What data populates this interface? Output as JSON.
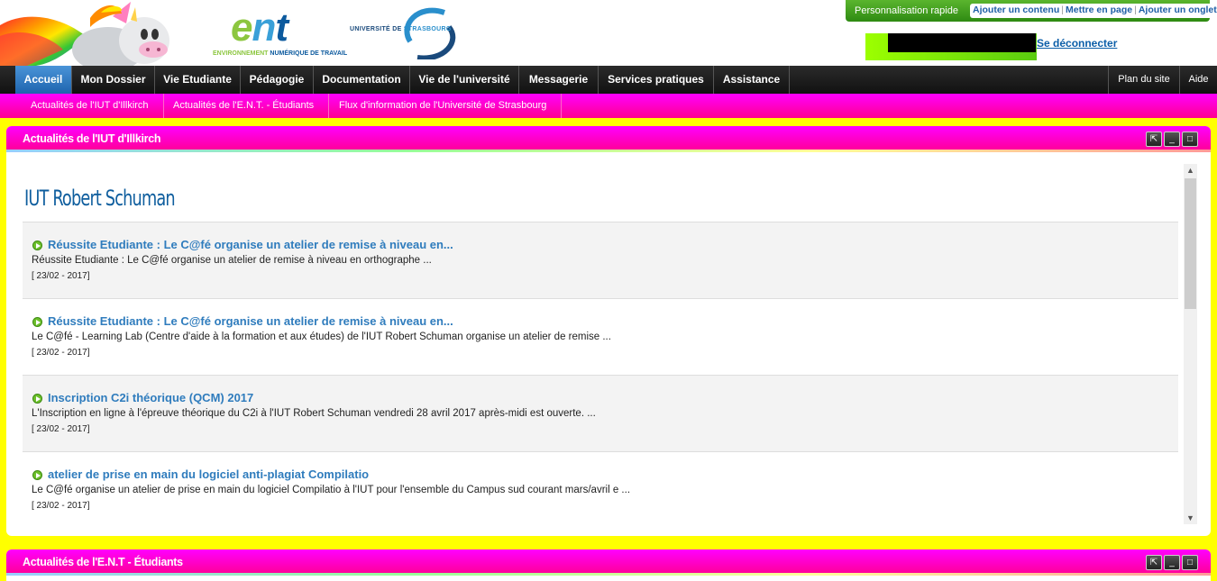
{
  "header": {
    "ent_letters": [
      "e",
      "n",
      "t"
    ],
    "ent_subtitle_a": "ENVIRONNEMENT",
    "ent_subtitle_b": "NUMÉRIQUE DE TRAVAIL",
    "unistra_a": "UNIVERSITÉ DE",
    "unistra_b": "STRASBOURG",
    "quick_label": "Personnalisation rapide",
    "quick_links": [
      "Ajouter un contenu",
      "Mettre en page",
      "Ajouter un onglet"
    ],
    "logout": "Se déconnecter"
  },
  "nav": {
    "items": [
      "Accueil",
      "Mon Dossier",
      "Vie Etudiante",
      "Pédagogie",
      "Documentation",
      "Vie de l'université",
      "Messagerie",
      "Services pratiques",
      "Assistance"
    ],
    "active_index": 0,
    "right": [
      "Plan du site",
      "Aide"
    ]
  },
  "subnav": [
    "Actualités de l'IUT d'Illkirch",
    "Actualités de l'E.N.T. - Étudiants",
    "Flux d'information de l'Université de Strasbourg"
  ],
  "portlet1": {
    "title": "Actualités de l'IUT d'Illkirch",
    "heading": "IUT Robert Schuman",
    "news": [
      {
        "title": "Réussite Etudiante : Le C@fé organise un atelier de remise à niveau en...",
        "desc": "Réussite Etudiante : Le C@fé organise un atelier de remise à niveau en orthographe ...",
        "date": "[ 23/02 - 2017]"
      },
      {
        "title": "Réussite Etudiante : Le C@fé organise un atelier de remise à niveau en...",
        "desc": "Le C@fé - Learning Lab (Centre d'aide à la formation et aux études) de l'IUT Robert Schuman organise un atelier de remise ...",
        "date": "[ 23/02 - 2017]"
      },
      {
        "title": "Inscription C2i théorique (QCM) 2017",
        "desc": "L'Inscription en ligne à l'épreuve théorique du C2i à l'IUT Robert Schuman vendredi 28 avril 2017 après-midi est ouverte. ...",
        "date": "[ 23/02 - 2017]"
      },
      {
        "title": "atelier de prise en main du logiciel anti-plagiat Compilatio",
        "desc": "Le C@fé organise un atelier de prise en main du logiciel Compilatio à l'IUT pour l'ensemble du Campus sud courant mars/avril e ...",
        "date": "[ 23/02 - 2017]"
      }
    ]
  },
  "portlet2": {
    "title": "Actualités de l'E.N.T - Étudiants"
  },
  "colors": {
    "page_background": "#ffff00",
    "magenta": "#ff00ff",
    "accent_blue": "#1e64ae",
    "link_blue": "#2f7cbd",
    "green": "#5ab52e"
  },
  "icons": {
    "popout": "external-window-icon",
    "minimize": "minimize-icon",
    "maximize": "maximize-icon",
    "news_bullet": "play-circle-icon",
    "scroll_up": "chevron-up-icon",
    "scroll_down": "chevron-down-icon"
  }
}
